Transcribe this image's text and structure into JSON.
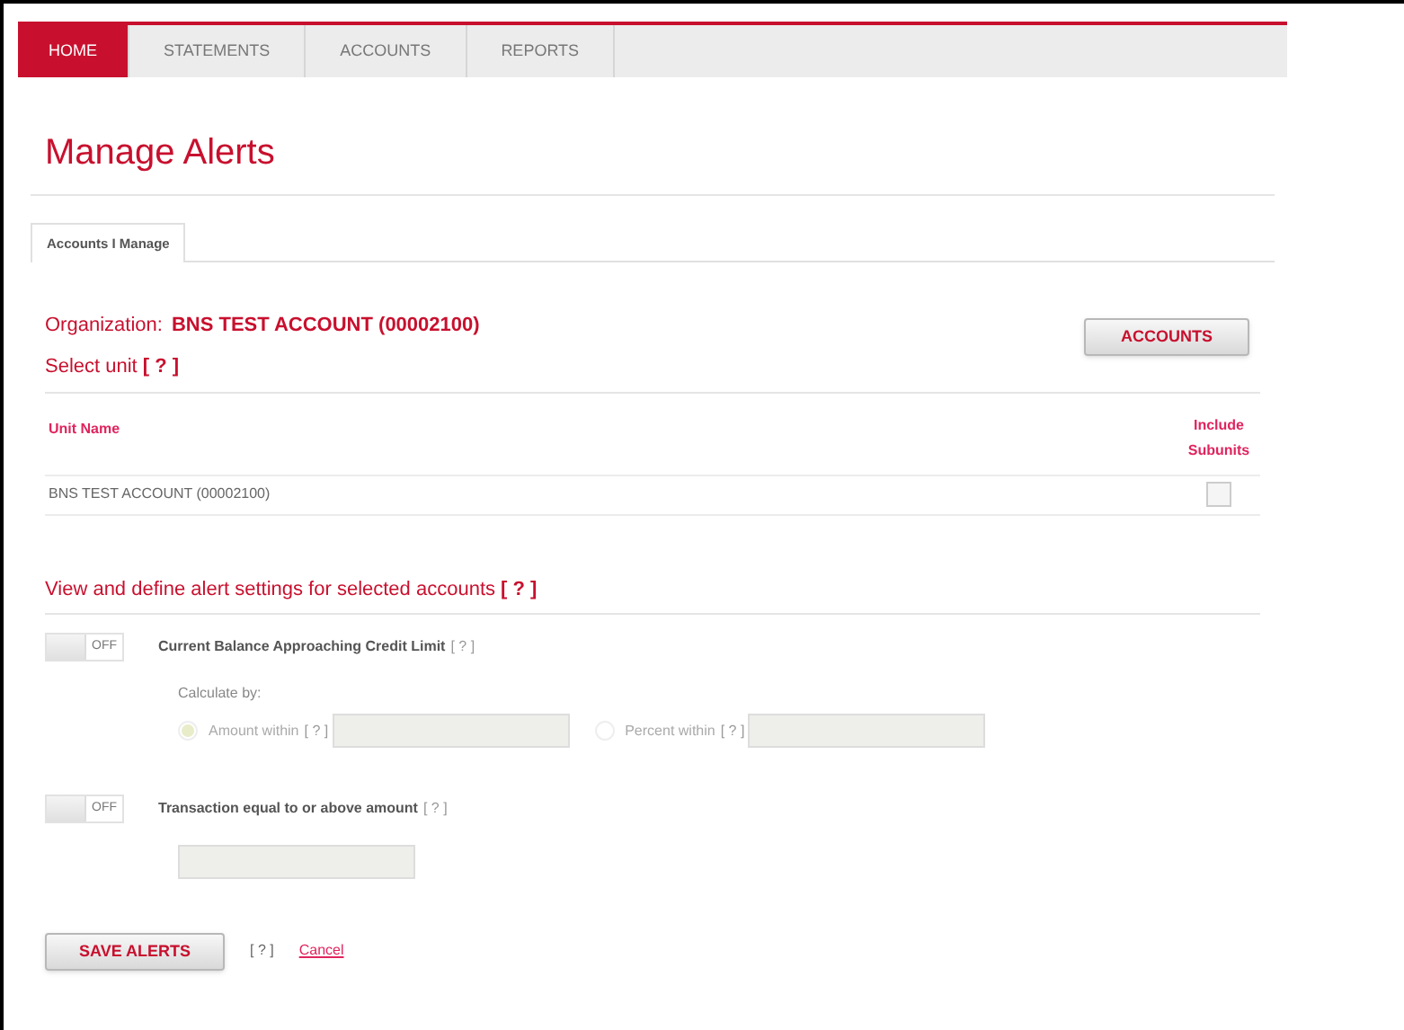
{
  "nav": [
    {
      "label": "HOME",
      "selected": true
    },
    {
      "label": "STATEMENTS",
      "selected": false
    },
    {
      "label": "ACCOUNTS",
      "selected": false
    },
    {
      "label": "REPORTS",
      "selected": false
    }
  ],
  "title": "Manage Alerts",
  "subtabs": [
    {
      "label": "Accounts I Manage",
      "selected": true
    }
  ],
  "organization": {
    "label": "Organization:",
    "value": "BNS TEST ACCOUNT (00002100)"
  },
  "accounts_button": "ACCOUNTS",
  "select_unit": {
    "label": "Select unit",
    "help": "[ ? ]"
  },
  "table": {
    "columns": [
      "Unit Name",
      "Include Subunits"
    ],
    "rows": [
      {
        "name": "BNS TEST ACCOUNT (00002100)",
        "checked": false
      }
    ]
  },
  "alerts_heading": {
    "label": "View and define alert settings for selected accounts",
    "help": "[ ? ]"
  },
  "alerts": [
    {
      "kind": "options",
      "toggle": "OFF",
      "on": false,
      "label": "Current Balance Approaching Credit Limit",
      "help": "[ ? ]",
      "calc_label": "Calculate by:",
      "options": [
        {
          "label": "Amount within",
          "help": "[ ? ]",
          "selected": true
        },
        {
          "label": "Percent within",
          "help": "[ ? ]",
          "selected": false
        }
      ]
    },
    {
      "kind": "amount",
      "toggle": "OFF",
      "on": false,
      "label": "Transaction equal to or above amount",
      "help": "[ ? ]"
    }
  ],
  "save_button": "SAVE ALERTS",
  "save_help": "[ ? ]",
  "cancel": "Cancel"
}
